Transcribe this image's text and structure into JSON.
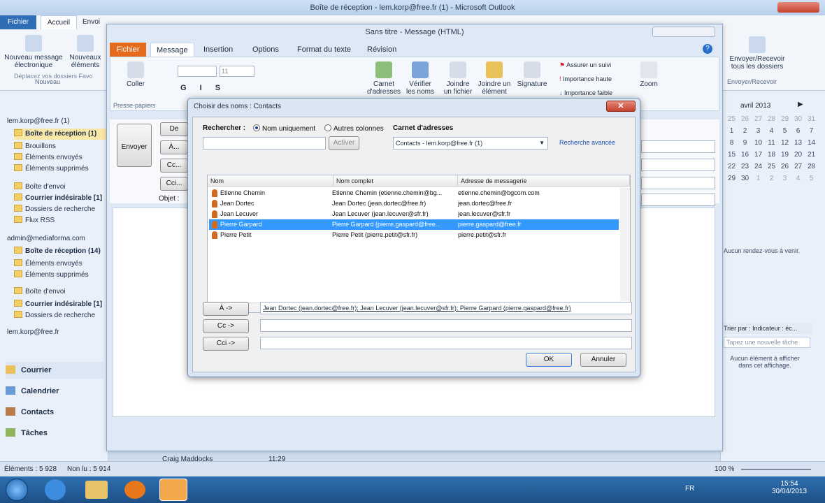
{
  "app": {
    "window_title": "Boîte de réception - lem.korp@free.fr (1) - Microsoft Outlook"
  },
  "main_tabs": [
    "Fichier",
    "Accueil",
    "Envoi"
  ],
  "main_ribbon": {
    "new_message": "Nouveau message électronique",
    "new_items": "Nouveaux éléments",
    "group_new": "Nouveau",
    "send_receive_all": "Envoyer/Recevoir tous les dossiers",
    "group_send_receive": "Envoyer/Recevoir",
    "drag_hint": "Déplacez vos dossiers Favo"
  },
  "folders": {
    "account1": "lem.korp@free.fr (1)",
    "items1": [
      "Boîte de réception (1)",
      "Brouillons",
      "Éléments envoyés",
      "Éléments supprimés",
      "Boîte d'envoi",
      "Courrier indésirable [1]",
      "Dossiers de recherche",
      "Flux RSS"
    ],
    "account2": "admin@mediaforma.com",
    "items2": [
      "Boîte de réception (14)",
      "Éléments envoyés",
      "Éléments supprimés",
      "Boîte d'envoi",
      "Courrier indésirable [1]",
      "Dossiers de recherche"
    ],
    "account3": "lem.korp@free.fr"
  },
  "nav": {
    "mail": "Courrier",
    "calendar": "Calendrier",
    "contacts": "Contacts",
    "tasks": "Tâches"
  },
  "calendar": {
    "month": "avril 2013",
    "weeks": [
      [
        "25",
        "26",
        "27",
        "28",
        "29",
        "30",
        "31"
      ],
      [
        "1",
        "2",
        "3",
        "4",
        "5",
        "6",
        "7"
      ],
      [
        "8",
        "9",
        "10",
        "11",
        "12",
        "13",
        "14"
      ],
      [
        "15",
        "16",
        "17",
        "18",
        "19",
        "20",
        "21"
      ],
      [
        "22",
        "23",
        "24",
        "25",
        "26",
        "27",
        "28"
      ],
      [
        "29",
        "30",
        "1",
        "2",
        "3",
        "4",
        "5"
      ]
    ]
  },
  "right_pane": {
    "appointments": "Aucun rendez-vous à venir.",
    "arrange_by": "Trier par : Indicateur : éc...",
    "new_task": "Tapez une nouvelle tâche",
    "no_items": "Aucun élément à afficher dans cet affichage."
  },
  "status": {
    "items": "Éléments : 5 928",
    "unread": "Non lu : 5 914",
    "zoom": "100 %",
    "sender": "Craig Maddocks",
    "time": "11:29"
  },
  "taskbar": {
    "lang": "FR",
    "time": "15:54",
    "date": "30/04/2013"
  },
  "message": {
    "title": "Sans titre - Message (HTML)",
    "tabs": [
      "Fichier",
      "Message",
      "Insertion",
      "Options",
      "Format du texte",
      "Révision"
    ],
    "paste": "Coller",
    "group_clipboard": "Presse-papiers",
    "font_size": "11",
    "address_book": "Carnet d'adresses",
    "check_names": "Vérifier les noms",
    "attach_file": "Joindre un fichier",
    "attach_item": "Joindre un élément",
    "signature": "Signature",
    "follow_up": "Assurer un suivi",
    "high_importance": "Importance haute",
    "low_importance": "Importance faible",
    "zoom": "Zoom",
    "send": "Envoyer",
    "to": "À...",
    "cc": "Cc...",
    "bcc": "Cci...",
    "from": "De",
    "subject": "Objet :"
  },
  "dialog": {
    "title": "Choisir des noms : Contacts",
    "search_label": "Rechercher :",
    "opt_name_only": "Nom uniquement",
    "opt_other_cols": "Autres colonnes",
    "address_book_label": "Carnet d'adresses",
    "go_button": "Activer",
    "address_book_value": "Contacts - lem.korp@free.fr (1)",
    "advanced_search": "Recherche avancée",
    "columns": [
      "Nom",
      "Nom complet",
      "Adresse de messagerie"
    ],
    "contacts": [
      {
        "name": "Etienne Chemin",
        "full": "Etienne Chemin (etienne.chemin@bg...",
        "email": "etienne.chemin@bgcom.com"
      },
      {
        "name": "Jean Dortec",
        "full": "Jean Dortec (jean.dortec@free.fr)",
        "email": "jean.dortec@free.fr"
      },
      {
        "name": "Jean Lecuver",
        "full": "Jean Lecuver (jean.lecuver@sfr.fr)",
        "email": "jean.lecuver@sfr.fr"
      },
      {
        "name": "Pierre Garpard",
        "full": "Pierre Garpard (pierre.gaspard@free...",
        "email": "pierre.gaspard@free.fr"
      },
      {
        "name": "Pierre Petit",
        "full": "Pierre Petit (pierre.petit@sfr.fr)",
        "email": "pierre.petit@sfr.fr"
      }
    ],
    "to_button": "À ->",
    "cc_button": "Cc ->",
    "bcc_button": "Cci ->",
    "to_value": "Jean Dortec (jean.dortec@free.fr); Jean Lecuver (jean.lecuver@sfr.fr); Pierre Garpard (pierre.gaspard@free.fr)",
    "cc_value": "",
    "bcc_value": "",
    "ok": "OK",
    "cancel": "Annuler"
  }
}
